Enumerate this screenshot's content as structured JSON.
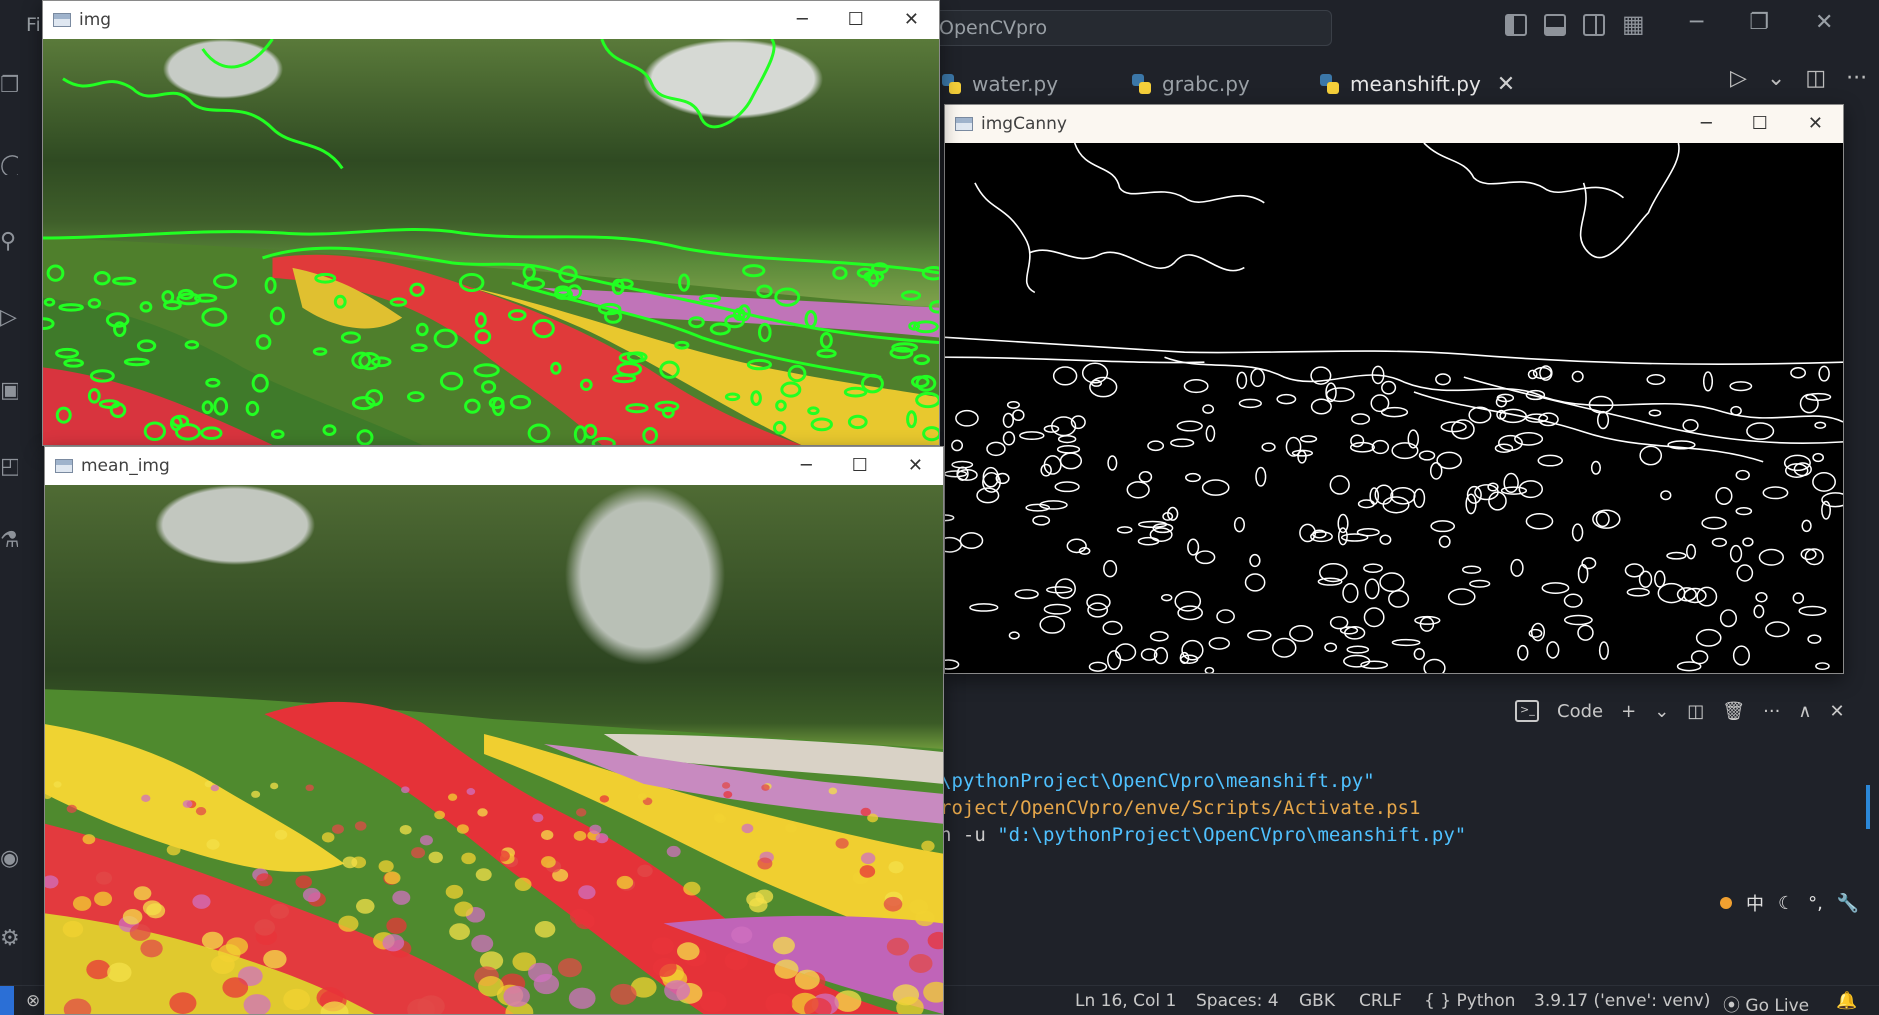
{
  "vscode": {
    "menu_clip": "Fi",
    "search_text": "OpenCVpro",
    "window_controls": [
      "─",
      "❐",
      "✕"
    ],
    "tabs": [
      {
        "label": "water.py",
        "active": false
      },
      {
        "label": "grabc.py",
        "active": false
      },
      {
        "label": "meanshift.py",
        "active": true
      }
    ],
    "tab_close": "✕",
    "editor_actions": [
      "▷",
      "⌄",
      "◫",
      "···"
    ],
    "panel": {
      "code_label": "Code",
      "buttons": [
        "+",
        "⌄",
        "◫",
        "🗑",
        "···",
        "∧",
        "✕"
      ]
    },
    "terminal": {
      "line1": "\\pythonProject\\OpenCVpro\\meanshift.py\"",
      "line2": "roject/OpenCVpro/enve/Scripts/Activate.ps1",
      "line3_prefix": "n -u ",
      "line3_path": "\"d:\\pythonProject\\OpenCVpro\\meanshift.py\""
    },
    "ime_tray": [
      "中",
      "☾",
      "°,",
      "🔧"
    ],
    "statusbar": {
      "position": "Ln 16, Col 1",
      "spaces": "Spaces: 4",
      "encoding": "GBK",
      "eol": "CRLF",
      "language": "{ } Python",
      "interpreter": "3.9.17 ('enve': venv)",
      "golive": "Go Live",
      "bell": "🔔"
    }
  },
  "windows": {
    "img": {
      "title": "img"
    },
    "mean_img": {
      "title": "mean_img"
    },
    "canny": {
      "title": "imgCanny"
    },
    "controls": {
      "minimize": "─",
      "maximize": "☐",
      "close": "✕"
    }
  }
}
